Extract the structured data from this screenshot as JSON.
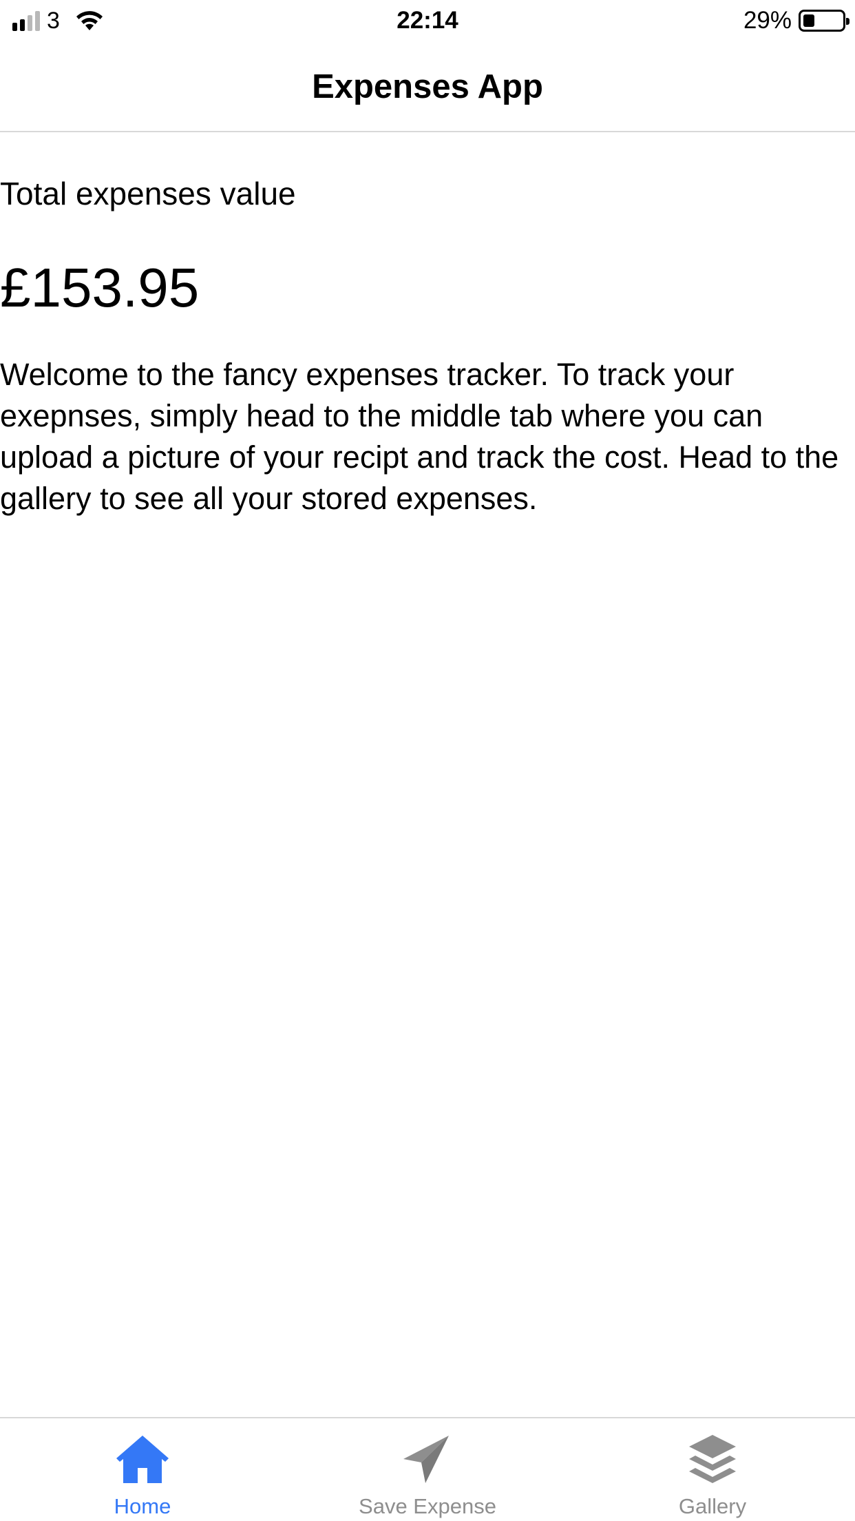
{
  "status_bar": {
    "carrier": "3",
    "time": "22:14",
    "battery_percent": "29%",
    "battery_level": 0.29,
    "signal_bars_filled": 2,
    "signal_bars_total": 4
  },
  "nav": {
    "title": "Expenses App"
  },
  "main": {
    "total_label": "Total expenses value",
    "total_value": "£153.95",
    "welcome_text": "Welcome to the fancy expenses tracker. To track your exepnses, simply head to the middle tab where you can upload a picture of your recipt and track the cost. Head to the gallery to see all your stored expenses."
  },
  "tabs": [
    {
      "label": "Home",
      "icon": "home-icon",
      "active": true
    },
    {
      "label": "Save Expense",
      "icon": "paper-plane-icon",
      "active": false
    },
    {
      "label": "Gallery",
      "icon": "layers-icon",
      "active": false
    }
  ],
  "colors": {
    "active_tab": "#3478f6",
    "inactive_tab": "#8e8e8e",
    "divider": "#d8d8d8"
  }
}
